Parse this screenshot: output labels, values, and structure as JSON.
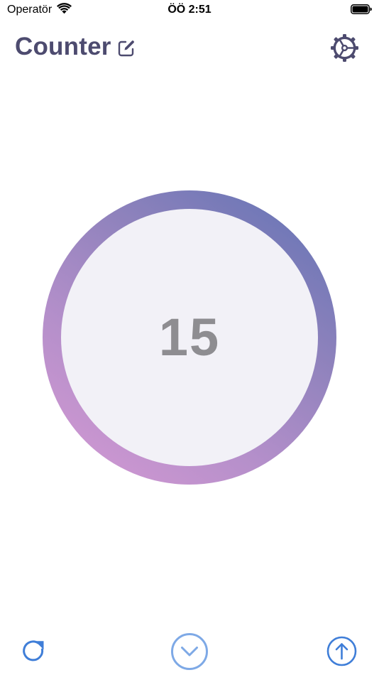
{
  "status_bar": {
    "carrier": "Operatör",
    "time": "ÖÖ 2:51",
    "wifi_icon": "wifi-icon",
    "battery_icon": "battery-icon"
  },
  "header": {
    "title": "Counter",
    "edit_icon": "edit-icon",
    "settings_icon": "gear-icon"
  },
  "counter": {
    "value": "15",
    "gradient_colors": [
      "#5f72b4",
      "#8e82bc",
      "#b48fca",
      "#d79ad4"
    ],
    "face_color": "#f2f1f7",
    "value_color": "#8e8d91"
  },
  "controls": {
    "reset_icon": "reset-icon",
    "decrement_icon": "chevron-down-icon",
    "increment_icon": "arrow-up-icon",
    "accent_color": "#3f7ed8"
  },
  "colors": {
    "title": "#4d4b6f"
  }
}
